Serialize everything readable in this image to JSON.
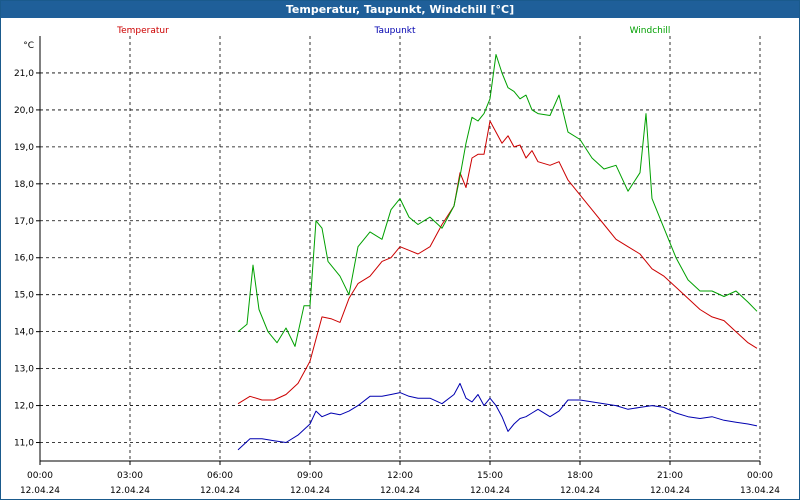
{
  "window": {
    "title": "Temperatur, Taupunkt, Windchill [°C]"
  },
  "chart_data": {
    "type": "line",
    "title": "Temperatur, Taupunkt, Windchill [°C]",
    "ylabel": "°C",
    "ylim": [
      10.5,
      22.0
    ],
    "yticks": [
      "11,0",
      "12,0",
      "13,0",
      "14,0",
      "15,0",
      "16,0",
      "17,0",
      "18,0",
      "19,0",
      "20,0",
      "21,0"
    ],
    "ytick_values": [
      11,
      12,
      13,
      14,
      15,
      16,
      17,
      18,
      19,
      20,
      21
    ],
    "xlim": [
      0,
      24
    ],
    "xticks": [
      {
        "time": "00:00",
        "date": "12.04.24",
        "hour": 0
      },
      {
        "time": "03:00",
        "date": "12.04.24",
        "hour": 3
      },
      {
        "time": "06:00",
        "date": "12.04.24",
        "hour": 6
      },
      {
        "time": "09:00",
        "date": "12.04.24",
        "hour": 9
      },
      {
        "time": "12:00",
        "date": "12.04.24",
        "hour": 12
      },
      {
        "time": "15:00",
        "date": "12.04.24",
        "hour": 15
      },
      {
        "time": "18:00",
        "date": "12.04.24",
        "hour": 18
      },
      {
        "time": "21:00",
        "date": "12.04.24",
        "hour": 21
      },
      {
        "time": "00:00",
        "date": "13.04.24",
        "hour": 24
      }
    ],
    "grid": true,
    "legend_position": "top",
    "series": [
      {
        "name": "Temperatur",
        "color": "#cc0000",
        "x": [
          6.6,
          7.0,
          7.4,
          7.8,
          8.2,
          8.6,
          9.0,
          9.2,
          9.4,
          9.7,
          10.0,
          10.3,
          10.6,
          11.0,
          11.4,
          11.7,
          12.0,
          12.3,
          12.6,
          13.0,
          13.4,
          13.8,
          14.0,
          14.2,
          14.4,
          14.6,
          14.8,
          15.0,
          15.2,
          15.4,
          15.6,
          15.8,
          16.0,
          16.2,
          16.4,
          16.6,
          17.0,
          17.3,
          17.6,
          18.0,
          18.4,
          18.8,
          19.2,
          19.6,
          20.0,
          20.4,
          20.8,
          21.2,
          21.6,
          22.0,
          22.4,
          22.8,
          23.2,
          23.6,
          23.9
        ],
        "y": [
          12.05,
          12.25,
          12.15,
          12.15,
          12.3,
          12.6,
          13.2,
          13.8,
          14.4,
          14.35,
          14.25,
          14.9,
          15.3,
          15.5,
          15.9,
          16.0,
          16.3,
          16.2,
          16.1,
          16.3,
          16.9,
          17.4,
          18.3,
          17.9,
          18.7,
          18.8,
          18.8,
          19.7,
          19.4,
          19.1,
          19.3,
          19.0,
          19.05,
          18.7,
          18.9,
          18.6,
          18.5,
          18.6,
          18.1,
          17.7,
          17.3,
          16.9,
          16.5,
          16.3,
          16.1,
          15.7,
          15.5,
          15.2,
          14.9,
          14.6,
          14.4,
          14.3,
          14.0,
          13.7,
          13.55
        ]
      },
      {
        "name": "Taupunkt",
        "color": "#0000b0",
        "x": [
          6.6,
          7.0,
          7.4,
          7.8,
          8.2,
          8.6,
          9.0,
          9.2,
          9.4,
          9.7,
          10.0,
          10.3,
          10.6,
          11.0,
          11.4,
          11.7,
          12.0,
          12.3,
          12.6,
          13.0,
          13.4,
          13.8,
          14.0,
          14.2,
          14.4,
          14.6,
          14.8,
          15.0,
          15.2,
          15.4,
          15.6,
          15.8,
          16.0,
          16.2,
          16.4,
          16.6,
          17.0,
          17.3,
          17.6,
          18.0,
          18.4,
          18.8,
          19.2,
          19.6,
          20.0,
          20.4,
          20.8,
          21.2,
          21.6,
          22.0,
          22.4,
          22.8,
          23.2,
          23.6,
          23.9
        ],
        "y": [
          10.8,
          11.1,
          11.1,
          11.05,
          11.0,
          11.2,
          11.5,
          11.85,
          11.7,
          11.8,
          11.75,
          11.85,
          12.0,
          12.25,
          12.25,
          12.3,
          12.35,
          12.25,
          12.2,
          12.2,
          12.05,
          12.3,
          12.6,
          12.2,
          12.1,
          12.3,
          12.0,
          12.2,
          12.0,
          11.7,
          11.3,
          11.5,
          11.65,
          11.7,
          11.8,
          11.9,
          11.7,
          11.85,
          12.15,
          12.15,
          12.1,
          12.05,
          12.0,
          11.9,
          11.95,
          12.0,
          11.95,
          11.8,
          11.7,
          11.65,
          11.7,
          11.6,
          11.55,
          11.5,
          11.45
        ]
      },
      {
        "name": "Windchill",
        "color": "#00a000",
        "x": [
          6.6,
          6.9,
          7.1,
          7.3,
          7.6,
          7.9,
          8.2,
          8.5,
          8.8,
          9.0,
          9.2,
          9.4,
          9.6,
          10.0,
          10.3,
          10.6,
          11.0,
          11.4,
          11.7,
          12.0,
          12.3,
          12.6,
          13.0,
          13.4,
          13.8,
          14.0,
          14.2,
          14.4,
          14.6,
          14.8,
          15.0,
          15.2,
          15.4,
          15.6,
          15.8,
          16.0,
          16.2,
          16.4,
          16.6,
          17.0,
          17.3,
          17.6,
          18.0,
          18.4,
          18.8,
          19.2,
          19.6,
          20.0,
          20.2,
          20.4,
          20.8,
          21.2,
          21.6,
          22.0,
          22.4,
          22.8,
          23.2,
          23.6,
          23.9
        ],
        "y": [
          14.0,
          14.2,
          15.8,
          14.6,
          14.0,
          13.7,
          14.1,
          13.6,
          14.7,
          14.7,
          17.0,
          16.8,
          15.9,
          15.5,
          15.0,
          16.3,
          16.7,
          16.5,
          17.3,
          17.6,
          17.1,
          16.9,
          17.1,
          16.8,
          17.4,
          18.2,
          19.1,
          19.8,
          19.7,
          19.9,
          20.3,
          21.5,
          21.0,
          20.6,
          20.5,
          20.3,
          20.4,
          20.0,
          19.9,
          19.85,
          20.4,
          19.4,
          19.2,
          18.7,
          18.4,
          18.5,
          17.8,
          18.3,
          19.9,
          17.6,
          16.8,
          16.0,
          15.4,
          15.1,
          15.1,
          14.95,
          15.1,
          14.8,
          14.55
        ]
      }
    ]
  }
}
